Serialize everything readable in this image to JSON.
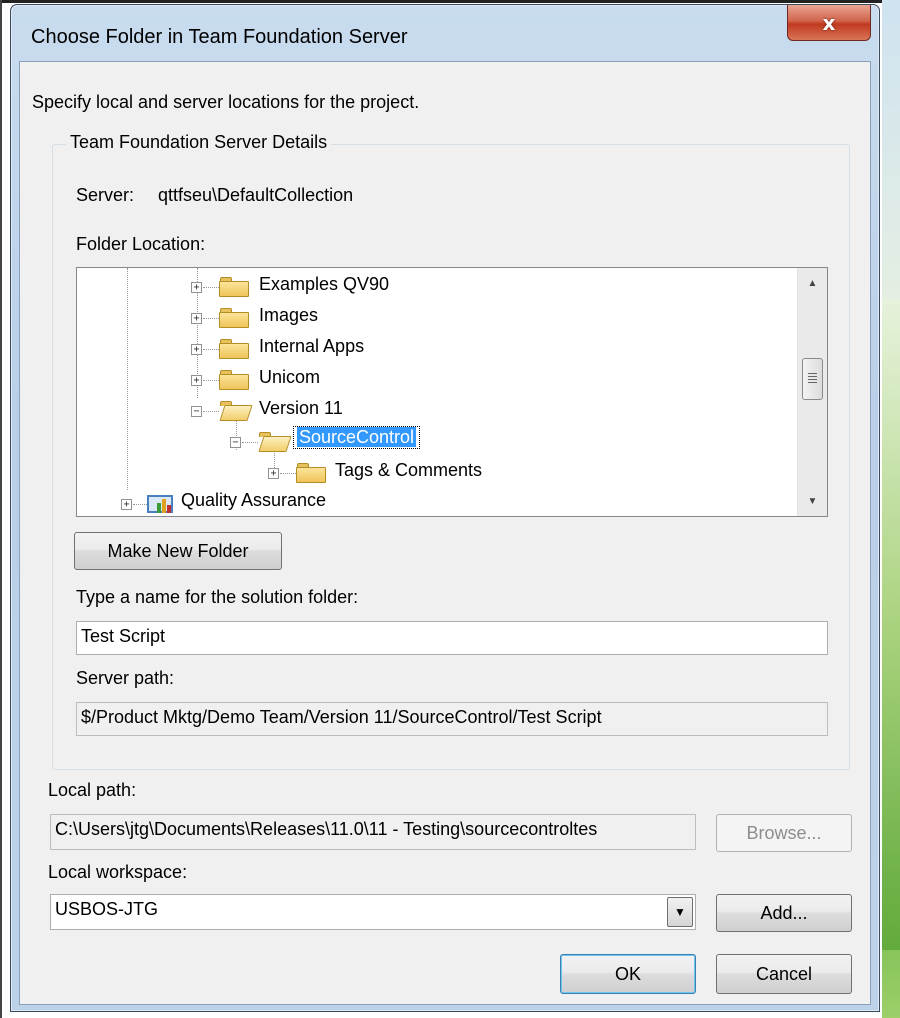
{
  "window": {
    "title": "Choose Folder in Team Foundation Server",
    "close_glyph": "x"
  },
  "instructions": "Specify local and server locations for the project.",
  "group": {
    "title": "Team Foundation Server Details",
    "server_label": "Server:",
    "server_value": "qttfseu\\DefaultCollection",
    "folder_location_label": "Folder Location:"
  },
  "tree": {
    "items": [
      {
        "label": "Examples QV90",
        "expander": "+"
      },
      {
        "label": "Images",
        "expander": "+"
      },
      {
        "label": "Internal Apps",
        "expander": "+"
      },
      {
        "label": "Unicom",
        "expander": "+"
      },
      {
        "label": "Version 11",
        "expander": "−"
      },
      {
        "label": "SourceControl",
        "expander": "−",
        "selected": true
      },
      {
        "label": "Tags & Comments",
        "expander": "+"
      },
      {
        "label": "Quality Assurance",
        "expander": "+",
        "icon": "team-project-icon"
      }
    ],
    "scroll_up_glyph": "▲",
    "scroll_down_glyph": "▼"
  },
  "make_new_folder_label": "Make New Folder",
  "solution_folder": {
    "label": "Type a name for the solution folder:",
    "value": "Test Script"
  },
  "server_path": {
    "label": "Server path:",
    "value": "$/Product Mktg/Demo Team/Version 11/SourceControl/Test Script"
  },
  "local_path": {
    "label": "Local path:",
    "value": "C:\\Users\\jtg\\Documents\\Releases\\11.0\\11 - Testing\\sourcecontroltes",
    "browse_label": "Browse..."
  },
  "local_workspace": {
    "label": "Local workspace:",
    "value": "USBOS-JTG",
    "add_label": "Add..."
  },
  "buttons": {
    "ok_label": "OK",
    "cancel_label": "Cancel"
  }
}
